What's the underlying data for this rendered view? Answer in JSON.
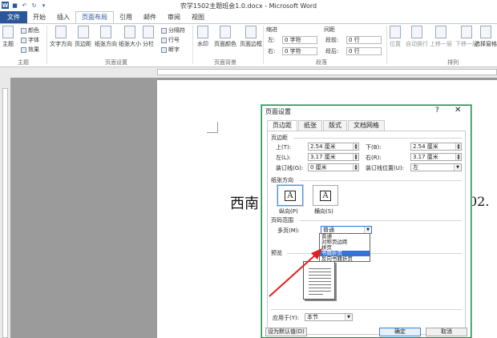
{
  "window": {
    "title": "农学1502主题班会1.0.docx - Microsoft Word",
    "word_letter": "W"
  },
  "tabs": [
    {
      "label": "文件"
    },
    {
      "label": "开始"
    },
    {
      "label": "插入"
    },
    {
      "label": "页面布局"
    },
    {
      "label": "引用"
    },
    {
      "label": "邮件"
    },
    {
      "label": "审阅"
    },
    {
      "label": "视图"
    }
  ],
  "ribbon": {
    "theme_group": {
      "label": "主题",
      "theme_btn": "主题",
      "colors": "颜色",
      "fonts": "字体",
      "effects": "效果"
    },
    "page_setup_group": {
      "label": "页面设置",
      "text_direction": "文字方向",
      "margins": "页边距",
      "orientation": "纸张方向",
      "size": "纸张大小",
      "columns": "分栏",
      "breaks": "分隔符",
      "line_numbers": "行号",
      "hyphenation": "断字"
    },
    "page_bg_group": {
      "label": "页面背景",
      "watermark": "水印",
      "page_color": "页面颜色",
      "page_borders": "页面边框"
    },
    "paragraph_group": {
      "label": "段落",
      "indent": "缩进",
      "spacing": "间距",
      "left_label": "左:",
      "left_val": "0 字符",
      "right_label": "右:",
      "right_val": "0 字符",
      "before_label": "段前:",
      "before_val": "0 行",
      "after_label": "段后:",
      "after_val": "0 行"
    },
    "arrange_group": {
      "label": "排列",
      "position": "位置",
      "wrap": "自动换行",
      "bring_forward": "上移一层",
      "send_backward": "下移一层",
      "selection_pane": "选择窗格"
    }
  },
  "document": {
    "text_left": "西南",
    "text_right": "02."
  },
  "dialog": {
    "title": "页面设置",
    "help": "?",
    "close": "✕",
    "tabs": [
      {
        "label": "页边距"
      },
      {
        "label": "纸张"
      },
      {
        "label": "版式"
      },
      {
        "label": "文档网格"
      }
    ],
    "margins_section": "页边距",
    "top_label": "上(T):",
    "top_val": "2.54 厘米",
    "bottom_label": "下(B):",
    "bottom_val": "2.54 厘米",
    "left_label": "左(L):",
    "left_val": "3.17 厘米",
    "right_label": "右(R):",
    "right_val": "3.17 厘米",
    "gutter_label": "装订线(G):",
    "gutter_val": "0 厘米",
    "gutter_pos_label": "装订线位置(U):",
    "gutter_pos_val": "左",
    "orientation_section": "纸张方向",
    "portrait_label": "纵向(P)",
    "landscape_label": "横向(S)",
    "orient_glyph": "A",
    "pages_section": "页码范围",
    "multiple_pages_label": "多页(M):",
    "multiple_pages_val": "普通",
    "dropdown_options": [
      "普通",
      "对称页边距",
      "拼页",
      "书籍折页",
      "反向书籍折页"
    ],
    "preview_section": "预览",
    "apply_label": "应用于(Y):",
    "apply_val": "本节",
    "default_btn": "设为默认值(D)",
    "ok_btn": "确定",
    "cancel_btn": "取消"
  }
}
